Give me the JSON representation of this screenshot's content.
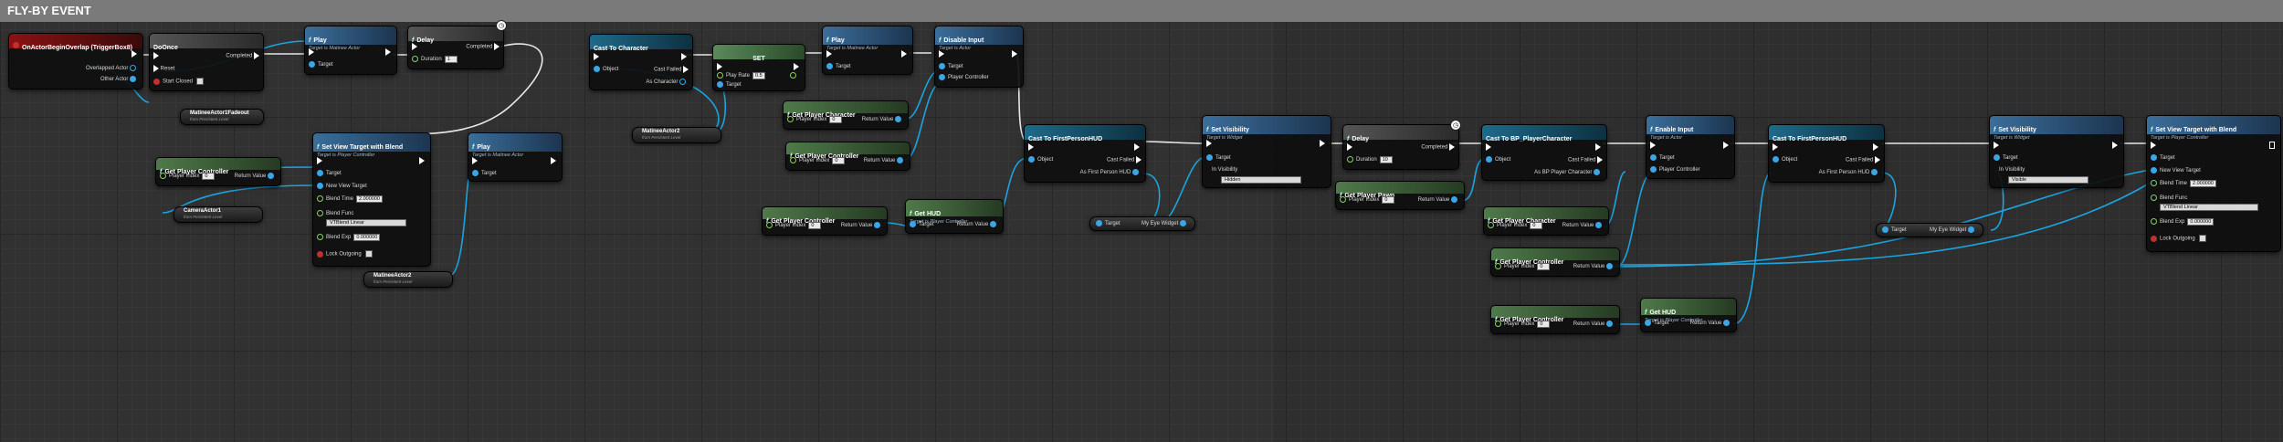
{
  "comment": {
    "title": "FLY-BY EVENT"
  },
  "nodes": {
    "begin_overlap": {
      "title": "OnActorBeginOverlap (TriggerBox8)",
      "overlapped": "Overlapped Actor",
      "other": "Other Actor"
    },
    "do_once": {
      "title": "DoOnce",
      "completed": "Completed",
      "reset": "Reset",
      "start_closed": "Start Closed"
    },
    "play1": {
      "title": "Play",
      "subtitle": "Target is Matinee Actor",
      "target": "Target"
    },
    "delay1": {
      "title": "Delay",
      "completed": "Completed",
      "duration": "Duration",
      "duration_value": "1"
    },
    "matinee_var1": {
      "title": "MatineeActor1Fadeout",
      "subtitle": "from Persistent Level"
    },
    "cast_char": {
      "title": "Cast To Character",
      "object": "Object",
      "cast_failed": "Cast Failed",
      "as_out": "As Character"
    },
    "set_node": {
      "title": "SET",
      "play_rate": "Play Rate",
      "play_rate_value": "0.5",
      "target": "Target"
    },
    "play2": {
      "title": "Play",
      "subtitle": "Target is Matinee Actor",
      "target": "Target"
    },
    "disable_input": {
      "title": "Disable Input",
      "subtitle": "Target is Actor",
      "target": "Target",
      "pc": "Player Controller"
    },
    "matinee_var2": {
      "title": "MatineeActor2",
      "subtitle": "from Persistent Level"
    },
    "get_player_char1": {
      "title": "Get Player Character",
      "player_index": "Player Index",
      "index_value": "0",
      "return": "Return Value"
    },
    "get_player_ctrl2": {
      "title": "Get Player Controller",
      "player_index": "Player Index",
      "index_value": "0",
      "return": "Return Value"
    },
    "get_player_ctrl1": {
      "title": "Get Player Controller",
      "player_index": "Player Index",
      "index_value": "0",
      "return": "Return Value"
    },
    "set_view_target1": {
      "title": "Set View Target with Blend",
      "subtitle": "Target is Player Controller",
      "target": "Target",
      "new_view": "New View Target",
      "blend_time": "Blend Time",
      "blend_time_value": "2.000000",
      "blend_func": "Blend Func",
      "blend_func_value": "VTBlend Linear",
      "blend_exp": "Blend Exp",
      "blend_exp_value": "0.000000",
      "lock": "Lock Outgoing"
    },
    "camera_var": {
      "title": "CameraActor1",
      "subtitle": "from Persistent Level"
    },
    "play3": {
      "title": "Play",
      "subtitle": "Target is Matinee Actor",
      "target": "Target"
    },
    "matinee_var3": {
      "title": "MatineeActor2",
      "subtitle": "from Persistent Level"
    },
    "get_player_ctrl3": {
      "title": "Get Player Controller",
      "player_index": "Player Index",
      "index_value": "0",
      "return": "Return Value"
    },
    "get_hud1": {
      "title": "Get HUD",
      "subtitle": "Target is Player Controller",
      "target": "Target",
      "return": "Return Value"
    },
    "cast_hud1": {
      "title": "Cast To FirstPersonHUD",
      "object": "Object",
      "cast_failed": "Cast Failed",
      "as_out": "As First Person HUD"
    },
    "target_eye1": {
      "target": "Target",
      "label": "My Eye Widget"
    },
    "set_visibility1": {
      "title": "Set Visibility",
      "subtitle": "Target is Widget",
      "target": "Target",
      "in_vis": "In Visibility",
      "vis_value": "Hidden"
    },
    "delay2": {
      "title": "Delay",
      "completed": "Completed",
      "duration": "Duration",
      "duration_value": "10"
    },
    "get_player_pawn": {
      "title": "Get Player Pawn",
      "player_index": "Player Index",
      "index_value": "0",
      "return": "Return Value"
    },
    "cast_bp_char": {
      "title": "Cast To BP_PlayerCharacter",
      "object": "Object",
      "cast_failed": "Cast Failed",
      "as_out": "As BP Player Character"
    },
    "get_player_char2": {
      "title": "Get Player Character",
      "player_index": "Player Index",
      "index_value": "0",
      "return": "Return Value"
    },
    "get_player_ctrl4": {
      "title": "Get Player Controller",
      "player_index": "Player Index",
      "index_value": "0",
      "return": "Return Value"
    },
    "enable_input": {
      "title": "Enable Input",
      "subtitle": "Target is Actor",
      "target": "Target",
      "pc": "Player Controller"
    },
    "get_player_ctrl5": {
      "title": "Get Player Controller",
      "player_index": "Player Index",
      "index_value": "0",
      "return": "Return Value"
    },
    "get_hud2": {
      "title": "Get HUD",
      "subtitle": "Target is Player Controller",
      "target": "Target",
      "return": "Return Value"
    },
    "cast_hud2": {
      "title": "Cast To FirstPersonHUD",
      "object": "Object",
      "cast_failed": "Cast Failed",
      "as_out": "As First Person HUD"
    },
    "target_eye2": {
      "target": "Target",
      "label": "My Eye Widget"
    },
    "set_visibility2": {
      "title": "Set Visibility",
      "subtitle": "Target is Widget",
      "target": "Target",
      "in_vis": "In Visibility",
      "vis_value": "Visible"
    },
    "set_view_target2": {
      "title": "Set View Target with Blend",
      "subtitle": "Target is Player Controller",
      "target": "Target",
      "new_view": "New View Target",
      "blend_time": "Blend Time",
      "blend_time_value": "2.000000",
      "blend_func": "Blend Func",
      "blend_func_value": "VTBlend Linear",
      "blend_exp": "Blend Exp",
      "blend_exp_value": "0.000000",
      "lock": "Lock Outgoing"
    }
  },
  "colors": {
    "exec_wire": "#e8e8e8",
    "object_wire": "#1aa4e0",
    "comment_header": "#7a7a7a"
  }
}
